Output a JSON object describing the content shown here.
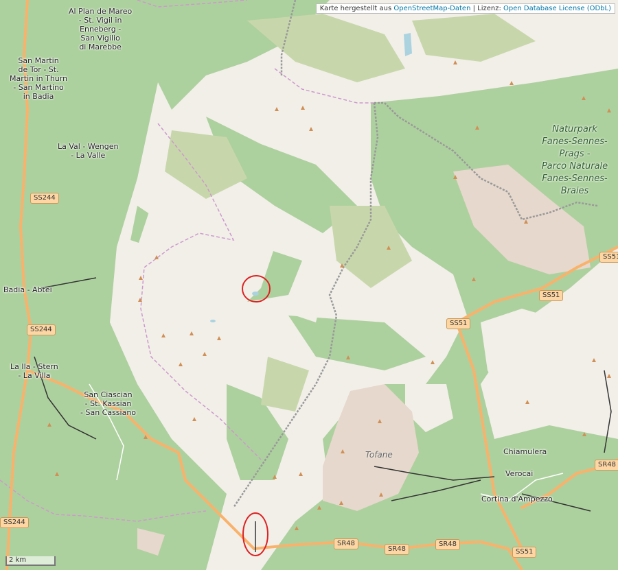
{
  "attribution": {
    "prefix": "Karte hergestellt aus ",
    "osm_link": "OpenStreetMap-Daten",
    "sep": " | Lizenz: ",
    "license_link": "Open Database License (ODbL)"
  },
  "places": {
    "al_plan": "Al Plan de Mareo\n- St. Vigil in\nEnneberg -\nSan Vigilio\ndi Marebbe",
    "san_martin": "San Martin\nde Tor - St.\nMartin in Thurn\n- San Martino\nin Badia",
    "la_val": "La Val - Wengen\n- La Valle",
    "badia": "Badia - Abtei",
    "la_ila": "La Ila - Stern\n- La Villa",
    "san_ciascian": "San Ciascian\n- St. Kassian\n- San Cassiano",
    "chiamulera": "Chiamulera",
    "verocai": "Verocai",
    "cortina": "Cortina d'Ampezzo"
  },
  "park_label": "Naturpark\nFanes-Sennes-\nPrags -\nParco Naturale\nFanes-Sennes-\nBraies",
  "mountain_label": "Tofane",
  "road_shields": {
    "ss244_a": "SS244",
    "ss244_b": "SS244",
    "ss244_c": "SS244",
    "ss51_a": "SS51",
    "ss51_b": "SS51",
    "ss51_c": "SS51",
    "ss51_d": "SS51",
    "sr48_a": "SR48",
    "sr48_b": "SR48",
    "sr48_c": "SR48",
    "sr48_d": "SR48"
  },
  "scale_label": "2 km",
  "colors": {
    "land": "#f2efe9",
    "forest": "#add19e",
    "scrub": "#c8d7ab",
    "rock": "#e6d8cc",
    "marker_circle": "#dd2222",
    "peak": "#d08f55",
    "boundary": "#cc99cc",
    "road": "#f9b26b"
  },
  "marker_circles": [
    {
      "label": "circle-upper"
    },
    {
      "label": "circle-lower"
    }
  ]
}
